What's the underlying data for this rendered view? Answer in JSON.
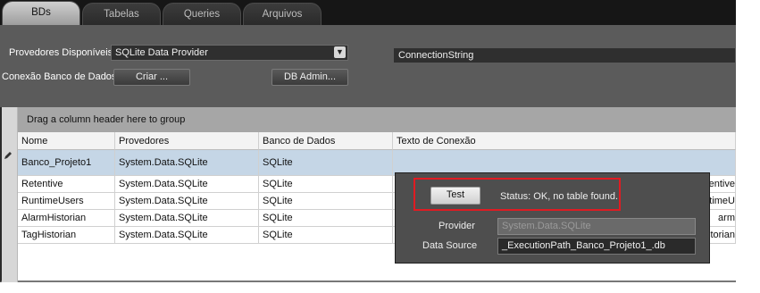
{
  "tabs": [
    {
      "label": "BDs",
      "active": true
    },
    {
      "label": "Tabelas",
      "active": false
    },
    {
      "label": "Queries",
      "active": false
    },
    {
      "label": "Arquivos",
      "active": false
    }
  ],
  "providers": {
    "label": "Provedores Disponíveis:",
    "selected": "SQLite Data Provider"
  },
  "connection": {
    "label": "Conexão Banco de Dados",
    "create_button": "Criar ...",
    "admin_button": "DB Admin..."
  },
  "grid": {
    "group_hint": "Drag a column header here to group",
    "columns": [
      "Nome",
      "Provedores",
      "Banco de Dados",
      "Texto de Conexão"
    ],
    "rows": [
      {
        "name": "Banco_Projeto1",
        "provider": "System.Data.SQLite",
        "db": "SQLite",
        "conn": "ConnectionString",
        "selected": true
      },
      {
        "name": "Retentive",
        "provider": "System.Data.SQLite",
        "db": "SQLite",
        "conn": "etentive",
        "selected": false
      },
      {
        "name": "RuntimeUsers",
        "provider": "System.Data.SQLite",
        "db": "SQLite",
        "conn": "untimeU",
        "selected": false
      },
      {
        "name": "AlarmHistorian",
        "provider": "System.Data.SQLite",
        "db": "SQLite",
        "conn": "arm",
        "selected": false
      },
      {
        "name": "TagHistorian",
        "provider": "System.Data.SQLite",
        "db": "SQLite",
        "conn": "storian",
        "selected": false
      }
    ]
  },
  "popup": {
    "test_button": "Test",
    "status": "Status: OK, no table found.",
    "provider_label": "Provider",
    "provider_value": "System.Data.SQLite",
    "datasource_label": "Data Source",
    "datasource_value": "_ExecutionPath_Banco_Projeto1_.db"
  },
  "colors": {
    "highlight": "#e01b22",
    "selected_row": "#c5d6e6"
  }
}
